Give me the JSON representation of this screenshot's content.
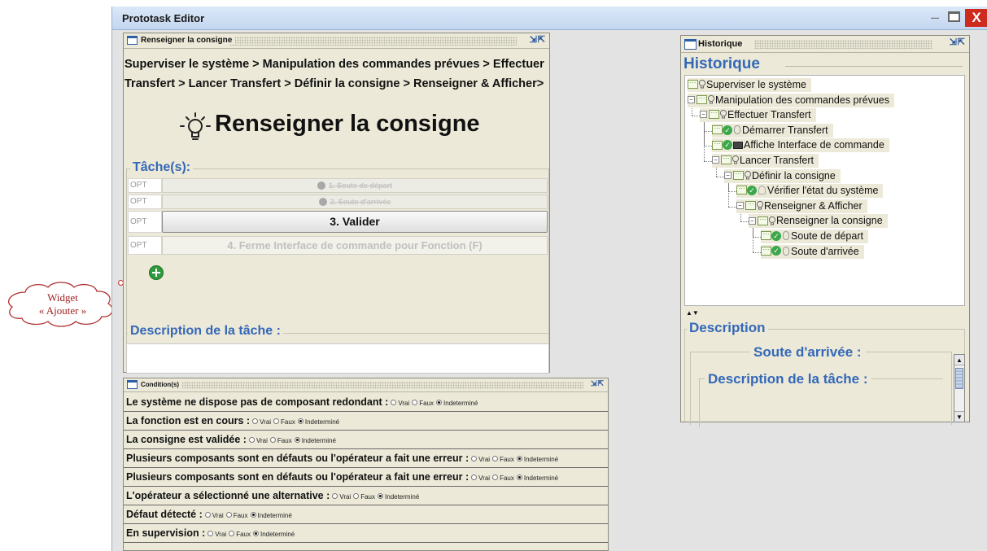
{
  "app": {
    "title": "Prototask Editor",
    "minimize": "–",
    "close": "X"
  },
  "consigne_frame": {
    "title": "Renseigner la consigne",
    "breadcrumb": "Superviser le système > Manipulation des commandes prévues > Effectuer Transfert > Lancer Transfert > Définir la consigne > Renseigner & Afficher>",
    "heading": "Renseigner la consigne",
    "tasks_group_title": "Tâche(s):",
    "tasks": [
      {
        "opt": "OPT",
        "label": "1. Soute de départ",
        "state": "done"
      },
      {
        "opt": "OPT",
        "label": "2. Soute d'arrivée",
        "state": "done"
      },
      {
        "opt": "OPT",
        "label": "3. Valider",
        "state": "active"
      },
      {
        "opt": "OPT",
        "label": "4. Ferme Interface de commande pour Fonction (F)",
        "state": "disabled"
      }
    ],
    "description_title": "Description de la tâche :"
  },
  "callout": {
    "line1": "Widget",
    "line2": "« Ajouter »"
  },
  "conditions_frame": {
    "title": "Condition(s)",
    "radio_labels": [
      "Vrai",
      "Faux",
      "Indeterminé"
    ],
    "rows": [
      {
        "label": "Le système ne dispose pas de composant redondant :",
        "selected": "Indeterminé"
      },
      {
        "label": "La fonction est en cours :",
        "selected": "Indeterminé"
      },
      {
        "label": "La consigne est validée :",
        "selected": "Indeterminé"
      },
      {
        "label": "Plusieurs composants sont en défauts ou l'opérateur a fait une erreur :",
        "selected": "Indeterminé"
      },
      {
        "label": "Plusieurs composants sont en défauts ou l'opérateur a fait une erreur :",
        "selected": "Indeterminé"
      },
      {
        "label": "L'opérateur a sélectionné une alternative :",
        "selected": "Indeterminé"
      },
      {
        "label": "Défaut détecté :",
        "selected": "Indeterminé"
      },
      {
        "label": "En supervision :",
        "selected": "Indeterminé"
      }
    ]
  },
  "historique_frame": {
    "title": "Historique",
    "group_title": "Historique",
    "tree": [
      {
        "label": "Superviser le système",
        "depth": 0,
        "icon": "bulb-icon",
        "expander": ""
      },
      {
        "label": "Manipulation des commandes prévues",
        "depth": 0,
        "icon": "bulb-icon",
        "expander": "−"
      },
      {
        "label": "Effectuer Transfert",
        "depth": 1,
        "icon": "bulb-icon",
        "expander": "−"
      },
      {
        "label": "Démarrer Transfert",
        "depth": 2,
        "icon": "mouse-icon",
        "expander": "",
        "done": true
      },
      {
        "label": "Affiche Interface de commande",
        "depth": 2,
        "icon": "screen-icon",
        "expander": "",
        "done": true
      },
      {
        "label": "Lancer Transfert",
        "depth": 2,
        "icon": "bulb-icon",
        "expander": "−"
      },
      {
        "label": "Définir la consigne",
        "depth": 3,
        "icon": "bulb-icon",
        "expander": "−"
      },
      {
        "label": "Vérifier l'état du système",
        "depth": 4,
        "icon": "person-icon",
        "expander": "",
        "done": true
      },
      {
        "label": "Renseigner & Afficher",
        "depth": 4,
        "icon": "bulb-icon",
        "expander": "−"
      },
      {
        "label": "Renseigner la consigne",
        "depth": 5,
        "icon": "bulb-icon",
        "expander": "−"
      },
      {
        "label": "Soute de départ",
        "depth": 6,
        "icon": "mouse-icon",
        "expander": "",
        "done": true
      },
      {
        "label": "Soute d'arrivée",
        "depth": 6,
        "icon": "mouse-icon",
        "expander": "",
        "done": true
      }
    ],
    "description_title": "Description",
    "selected_task": "Soute d'arrivée :",
    "task_description_title": "Description de la tâche :"
  }
}
